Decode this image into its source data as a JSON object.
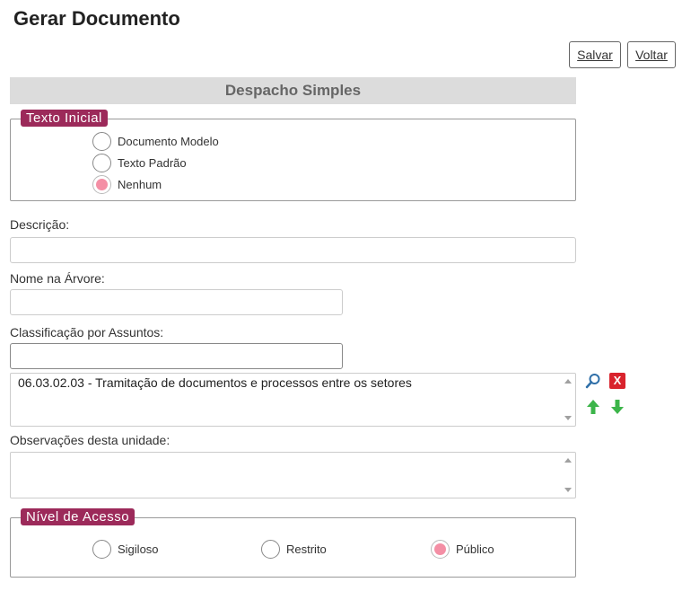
{
  "page": {
    "title": "Gerar Documento"
  },
  "toolbar": {
    "save_label": "Salvar",
    "back_label": "Voltar"
  },
  "section": {
    "title": "Despacho Simples"
  },
  "texto_inicial": {
    "legend": "Texto Inicial",
    "options": [
      {
        "label": "Documento Modelo",
        "checked": false
      },
      {
        "label": "Texto Padrão",
        "checked": false
      },
      {
        "label": "Nenhum",
        "checked": true
      }
    ]
  },
  "descricao": {
    "label": "Descrição:",
    "value": ""
  },
  "nome_arvore": {
    "label": "Nome na Árvore:",
    "value": ""
  },
  "classificacao": {
    "label": "Classificação por Assuntos:",
    "input_value": "",
    "items": [
      "06.03.02.03 - Tramitação de documentos e processos entre os setores"
    ]
  },
  "observacoes": {
    "label": "Observações desta unidade:",
    "value": ""
  },
  "nivel_acesso": {
    "legend": "Nível de Acesso",
    "options": [
      {
        "label": "Sigiloso",
        "checked": false
      },
      {
        "label": "Restrito",
        "checked": false
      },
      {
        "label": "Público",
        "checked": true
      }
    ]
  },
  "icons": {
    "search": "magnifier-icon",
    "remove": "remove-x-icon",
    "up": "arrow-up-icon",
    "down": "arrow-down-icon"
  },
  "colors": {
    "legend_bg": "#9c2a5a",
    "radio_checked": "#f48fa5",
    "remove_red": "#d9232d",
    "arrow_green": "#3cb54a",
    "search_blue": "#2f6fa8"
  }
}
